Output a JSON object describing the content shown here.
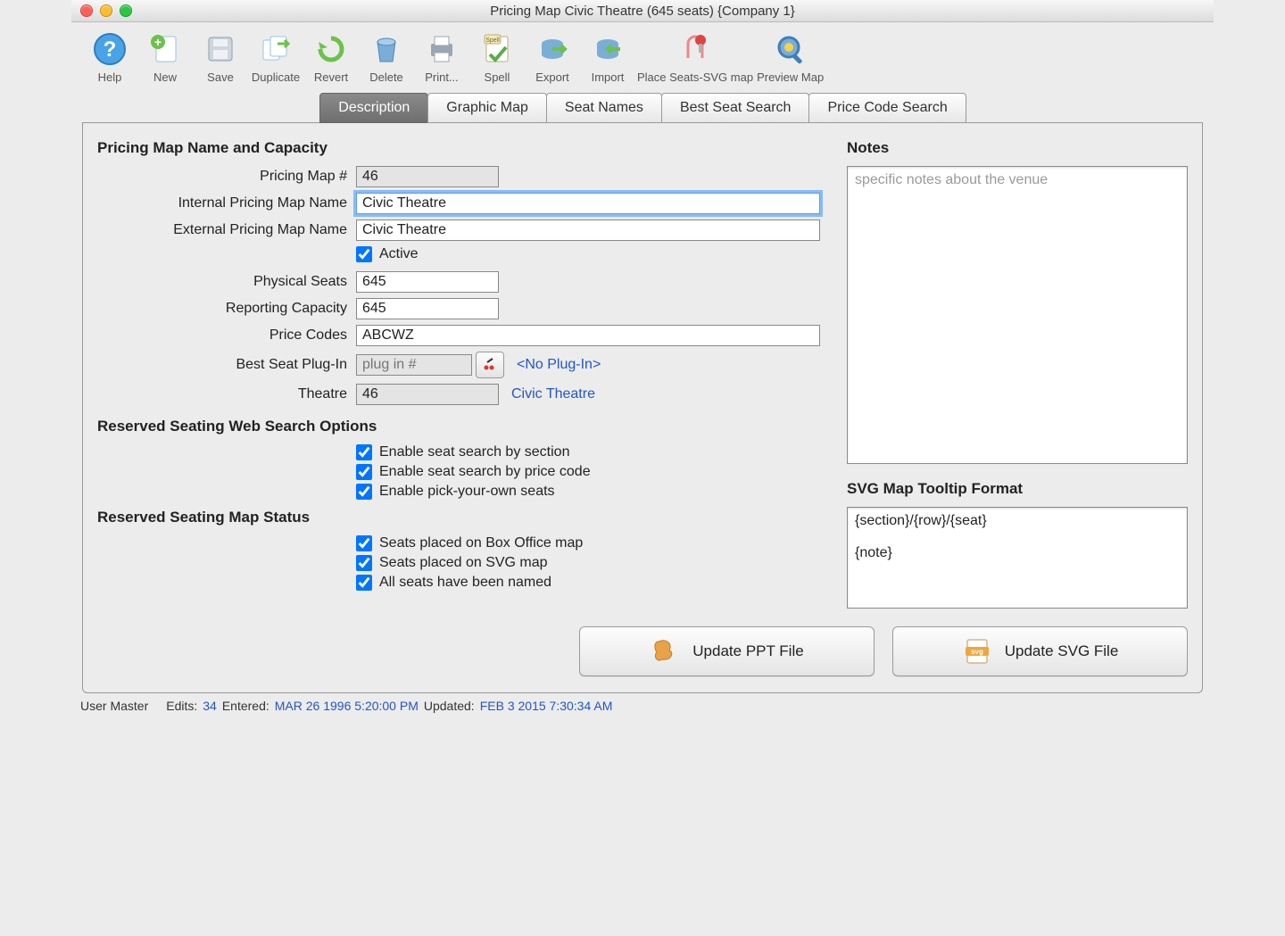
{
  "window": {
    "title": "Pricing Map Civic Theatre (645 seats) {Company 1}"
  },
  "toolbar": [
    {
      "id": "help",
      "label": "Help"
    },
    {
      "id": "new",
      "label": "New"
    },
    {
      "id": "save",
      "label": "Save"
    },
    {
      "id": "duplicate",
      "label": "Duplicate"
    },
    {
      "id": "revert",
      "label": "Revert"
    },
    {
      "id": "delete",
      "label": "Delete"
    },
    {
      "id": "print",
      "label": "Print..."
    },
    {
      "id": "spell",
      "label": "Spell"
    },
    {
      "id": "export",
      "label": "Export"
    },
    {
      "id": "import",
      "label": "Import"
    },
    {
      "id": "place-seats",
      "label": "Place Seats-SVG map"
    },
    {
      "id": "preview-map",
      "label": "Preview Map"
    }
  ],
  "tabs": [
    {
      "id": "description",
      "label": "Description",
      "active": true
    },
    {
      "id": "graphic-map",
      "label": "Graphic Map"
    },
    {
      "id": "seat-names",
      "label": "Seat Names"
    },
    {
      "id": "best-seat-search",
      "label": "Best Seat Search"
    },
    {
      "id": "price-code-search",
      "label": "Price Code Search"
    }
  ],
  "headings": {
    "name_capacity": "Pricing Map Name and Capacity",
    "notes": "Notes",
    "web_search": "Reserved Seating Web Search Options",
    "map_status": "Reserved Seating Map Status",
    "svg_tooltip": "SVG Map Tooltip Format"
  },
  "labels": {
    "pricing_map_num": "Pricing Map #",
    "internal_name": "Internal Pricing Map Name",
    "external_name": "External Pricing Map Name",
    "active": "Active",
    "physical_seats": "Physical Seats",
    "reporting_capacity": "Reporting Capacity",
    "price_codes": "Price Codes",
    "best_seat_plugin": "Best Seat Plug-In",
    "theatre": "Theatre"
  },
  "values": {
    "pricing_map_num": "46",
    "internal_name": "Civic Theatre",
    "external_name": "Civic Theatre",
    "active": true,
    "physical_seats": "645",
    "reporting_capacity": "645",
    "price_codes": "ABCWZ",
    "best_seat_plugin_placeholder": "plug in #",
    "best_seat_plugin_value": "",
    "plugin_link": "<No Plug-In>",
    "theatre": "46",
    "theatre_link": "Civic Theatre",
    "notes_placeholder": "specific notes about the venue",
    "svg_tooltip": "{section}/{row}/{seat}\n\n{note}"
  },
  "web_search_opts": [
    {
      "id": "search-section",
      "label": "Enable seat search by section",
      "checked": true
    },
    {
      "id": "search-price",
      "label": "Enable seat search by price code",
      "checked": true
    },
    {
      "id": "pick-own",
      "label": "Enable pick-your-own seats",
      "checked": true
    }
  ],
  "map_status_opts": [
    {
      "id": "placed-box",
      "label": "Seats placed on Box Office map",
      "checked": true
    },
    {
      "id": "placed-svg",
      "label": "Seats placed on SVG map",
      "checked": true
    },
    {
      "id": "all-named",
      "label": "All seats have been named",
      "checked": true
    }
  ],
  "buttons": {
    "update_ppt": "Update PPT File",
    "update_svg": "Update SVG File"
  },
  "status": {
    "user": "User Master",
    "edits_label": "Edits:",
    "edits": "34",
    "entered_label": "Entered:",
    "entered": "MAR 26 1996 5:20:00 PM",
    "updated_label": "Updated:",
    "updated": "FEB 3 2015 7:30:34 AM"
  }
}
